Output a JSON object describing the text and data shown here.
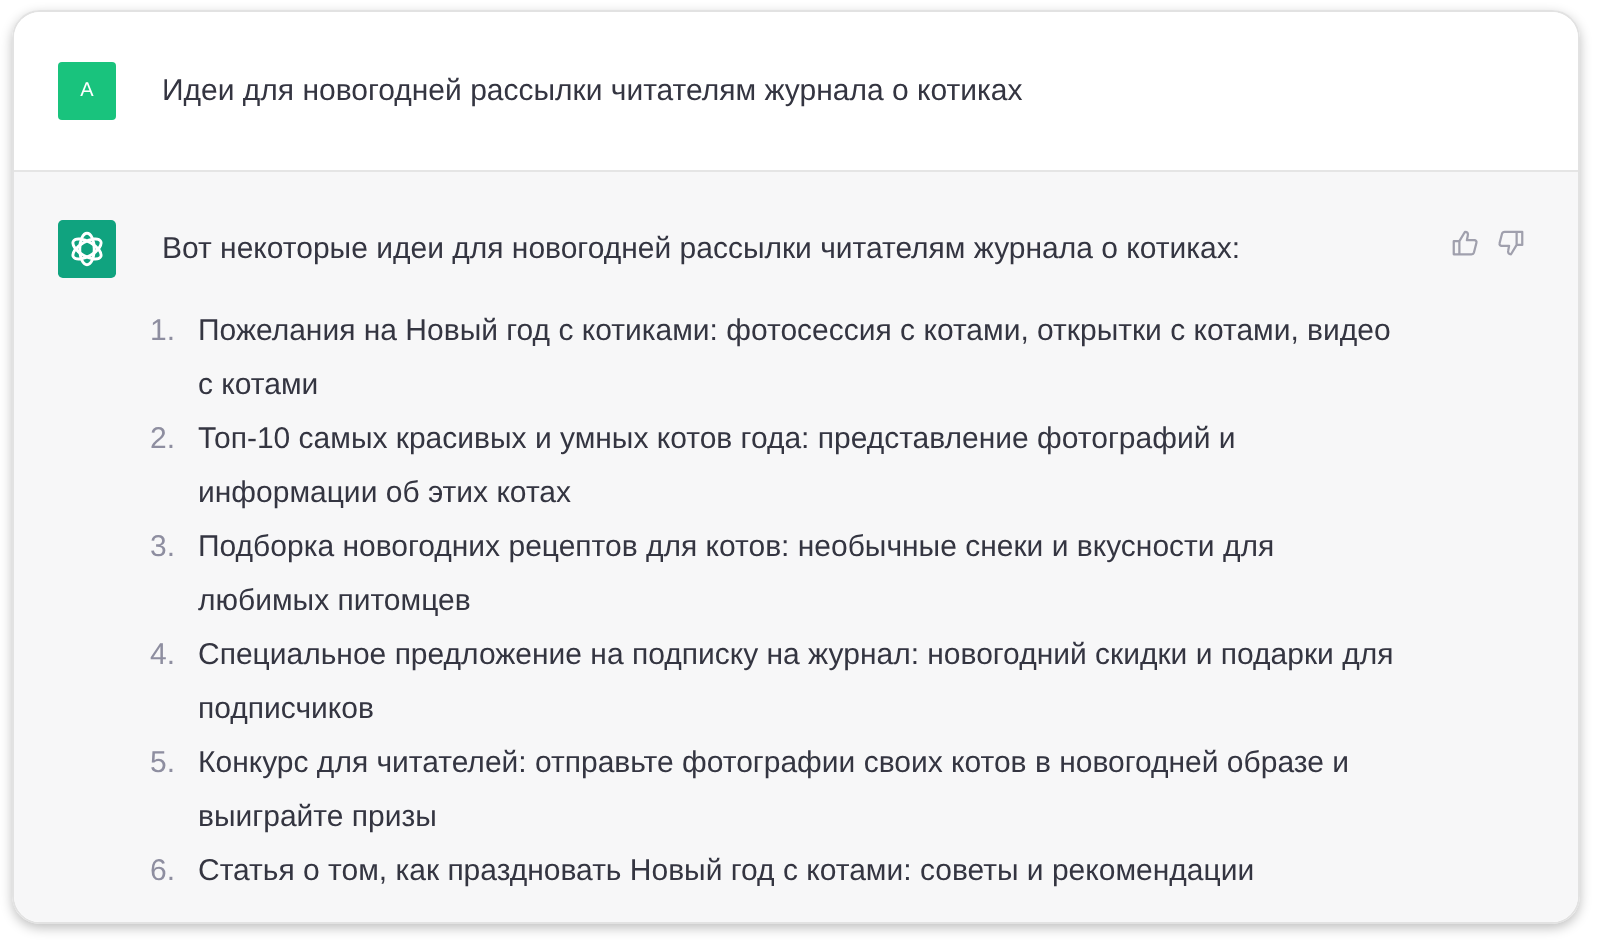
{
  "user_message": {
    "avatar": "A",
    "text": "Идеи для новогодней рассылки читателям журнала о котиках"
  },
  "assistant_message": {
    "intro": "Вот некоторые идеи для новогодней рассылки читателям журнала о котиках:",
    "items": [
      {
        "number": "1.",
        "text": "Пожелания на Новый год с котиками: фотосессия с котами, открытки с котами, видео с котами"
      },
      {
        "number": "2.",
        "text": "Топ-10 самых красивых и умных котов года: представление фотографий и информации об этих котах"
      },
      {
        "number": "3.",
        "text": "Подборка новогодних рецептов для котов: необычные снеки и вкусности для любимых питомцев"
      },
      {
        "number": "4.",
        "text": "Специальное предложение на подписку на журнал: новогодний скидки и подарки для подписчиков"
      },
      {
        "number": "5.",
        "text": "Конкурс для читателей: отправьте фотографии своих котов в новогодней образе и выиграйте призы"
      },
      {
        "number": "6.",
        "text": "Статья о том, как праздновать Новый год с котами: советы и рекомендации"
      }
    ]
  }
}
